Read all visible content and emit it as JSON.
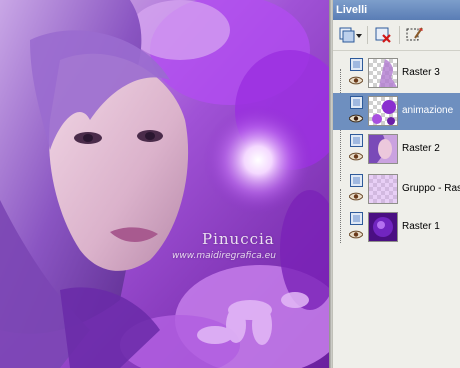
{
  "canvas": {
    "watermark_title": "Pinuccia",
    "watermark_sub": "www.maidiregrafica.eu"
  },
  "panel": {
    "title": "Livelli",
    "toolbar": {
      "new_layer_icon": "new-raster-layer-icon",
      "dropdown_icon": "chevron-down-icon",
      "delete_icon": "delete-layer-icon",
      "mask_icon": "edit-selection-icon"
    },
    "layers": [
      {
        "name": "Raster 3",
        "selected": false
      },
      {
        "name": "animazione",
        "selected": true
      },
      {
        "name": "Raster 2",
        "selected": false
      },
      {
        "name": "Gruppo - Ras",
        "selected": false
      },
      {
        "name": "Raster 1",
        "selected": false
      }
    ],
    "colors": {
      "title_bar": "#6a8cc0",
      "selected_row": "#6e8fbf",
      "panel_bg": "#efefea"
    }
  }
}
